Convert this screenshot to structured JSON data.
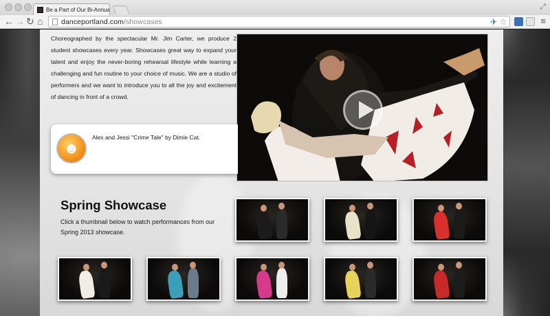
{
  "browser": {
    "tab_title": "Be a Part of Our Bi-Annual",
    "url_domain": "danceportland.com",
    "url_path": "/showcases"
  },
  "intro": {
    "text": "Choreographed by the spectacular Mr. Jim Carter, we produce 2 student showcases every year. Showcases great way to expand your talent and enjoy the never-boring rehearsal lifestyle while learning a challenging and fun routine to your choice of music. We are a studio of performers and we want to introduce you to all the joy and excitement of dancing in front of a crowd."
  },
  "featured_video": {
    "caption": "Alex and Jessi \"Crime Tale\" by Dimie Cat.",
    "icon": "theater-masks-icon"
  },
  "season": {
    "title": "Spring Showcase",
    "description": "Click a thumbnail below to watch performances from our Spring 2013 showcase."
  },
  "thumbnails": [
    {
      "name": "thumb-1",
      "dress": "#1b1b1b",
      "partner": "#2a2a2a"
    },
    {
      "name": "thumb-2",
      "dress": "#e8e2c8",
      "partner": "#161616"
    },
    {
      "name": "thumb-3",
      "dress": "#d9302e",
      "partner": "#1a1a1a"
    },
    {
      "name": "thumb-4",
      "dress": "#f1ece6",
      "partner": "#1a1a1a"
    },
    {
      "name": "thumb-5",
      "dress": "#3aa0b8",
      "partner": "#6a7c8a"
    },
    {
      "name": "thumb-6",
      "dress": "#d63a8a",
      "partner": "#eeeeee"
    },
    {
      "name": "thumb-7",
      "dress": "#e8d35a",
      "partner": "#2a2a2a"
    },
    {
      "name": "thumb-8",
      "dress": "#c82a2a",
      "partner": "#1c1c1c"
    }
  ]
}
